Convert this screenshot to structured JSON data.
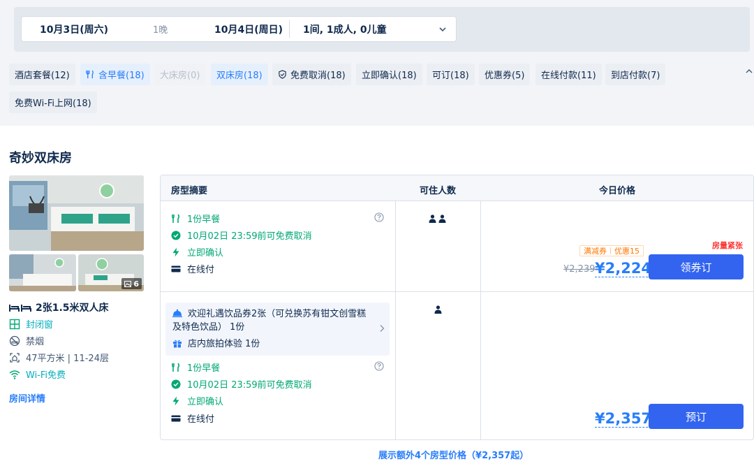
{
  "search": {
    "checkin": "10月3日(周六)",
    "nights": "1晚",
    "checkout": "10月4日(周日)",
    "guests": "1间, 1成人, 0儿童"
  },
  "filters": [
    {
      "label": "酒店套餐(12)",
      "state": "normal",
      "icon": ""
    },
    {
      "label": "含早餐(18)",
      "state": "active",
      "icon": "fork-knife-icon"
    },
    {
      "label": "大床房(0)",
      "state": "disabled",
      "icon": ""
    },
    {
      "label": "双床房(18)",
      "state": "active",
      "icon": ""
    },
    {
      "label": "免费取消(18)",
      "state": "normal",
      "icon": "shield-check-icon"
    },
    {
      "label": "立即确认(18)",
      "state": "normal",
      "icon": ""
    },
    {
      "label": "可订(18)",
      "state": "normal",
      "icon": ""
    },
    {
      "label": "优惠券(5)",
      "state": "normal",
      "icon": ""
    },
    {
      "label": "在线付款(11)",
      "state": "normal",
      "icon": ""
    },
    {
      "label": "到店付款(7)",
      "state": "normal",
      "icon": ""
    },
    {
      "label": "免费Wi-Fi上网(18)",
      "state": "normal",
      "icon": ""
    }
  ],
  "room": {
    "name": "奇妙双床房",
    "photo_count": "6",
    "bed": "2张1.5米双人床",
    "window": "封闭窗",
    "smoking": "禁烟",
    "area_floor": "47平方米 | 11-24层",
    "wifi": "Wi-Fi免费",
    "detail_link": "房间详情"
  },
  "table": {
    "col_summary": "房型摘要",
    "col_occupancy": "可住人数",
    "col_price": "今日价格"
  },
  "rates": [
    {
      "breakfast": "1份早餐",
      "cancel": "10月02日 23:59前可免费取消",
      "confirm": "立即确认",
      "payment": "在线付",
      "occupancy": 2,
      "promo_tag_1": "满减券",
      "promo_tag_2": "优惠15",
      "scarce": "房量紧张",
      "original_price": "¥2,239",
      "price": "¥2,224",
      "button": "领券订"
    },
    {
      "gift_line_1": "欢迎礼遇饮品券2张（可兑换苏有钳文创雪糕",
      "gift_line_2": "及特色饮品） 1份",
      "gift_line_3": "店内旅拍体验 1份",
      "breakfast": "1份早餐",
      "cancel": "10月02日 23:59前可免费取消",
      "confirm": "立即确认",
      "payment": "在线付",
      "occupancy": 1,
      "price": "¥2,357",
      "button": "预订"
    }
  ],
  "more_link": "展示额外4个房型价格（¥2,357起）",
  "colors": {
    "accent_blue": "#287dfa",
    "button_blue": "#3264f0",
    "green": "#00a874",
    "scarce_red": "#ff3434",
    "promo_orange": "#ff7700"
  }
}
